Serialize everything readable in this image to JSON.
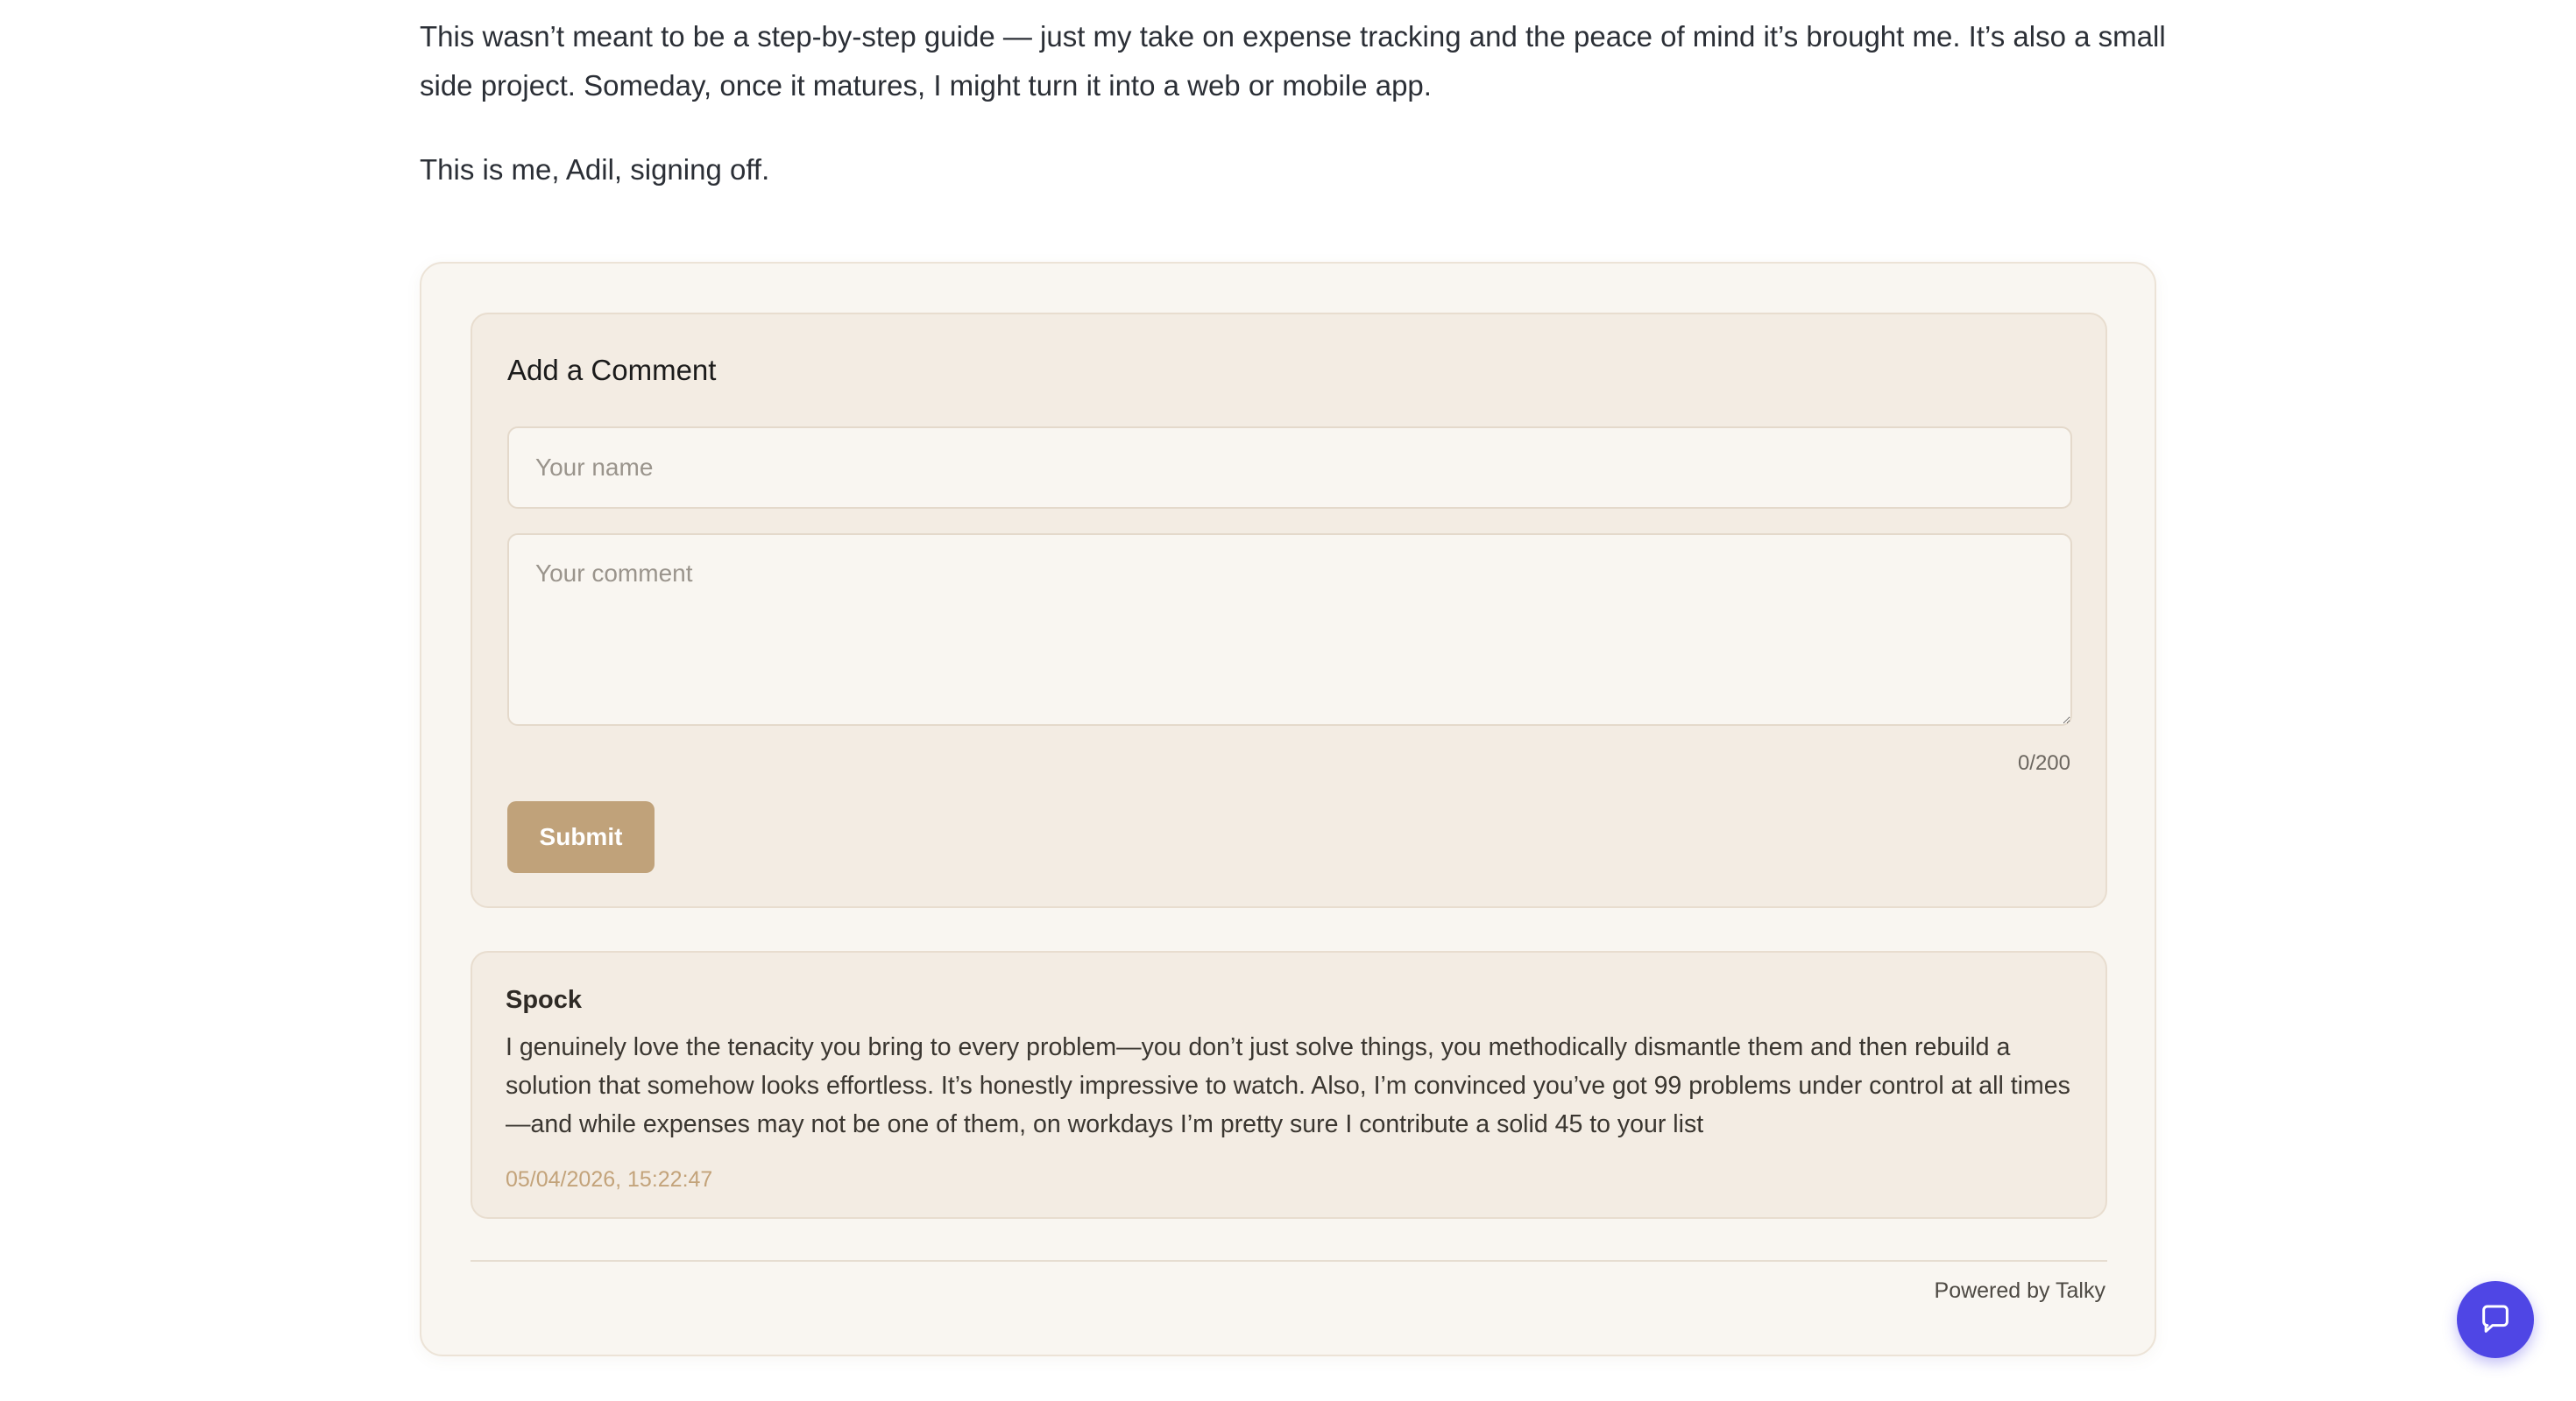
{
  "article": {
    "paragraph": "This wasn’t meant to be a step-by-step guide — just my take on expense tracking and the peace of mind it’s brought me. It’s also a small side project. Someday, once it matures, I might turn it into a web or mobile app.",
    "signoff": "This is me, Adil, signing off."
  },
  "comment_form": {
    "title": "Add a Comment",
    "name_placeholder": "Your name",
    "name_value": "",
    "comment_placeholder": "Your comment",
    "comment_value": "",
    "char_count": "0/200",
    "submit_label": "Submit"
  },
  "comments": [
    {
      "author": "Spock",
      "body": "I genuinely love the tenacity you bring to every problem—you don’t just solve things, you methodically dismantle them and then rebuild a solution that somehow looks effortless. It’s honestly impressive to watch. Also, I’m convinced you’ve got 99 problems under control at all times—and while expenses may not be one of them, on workdays I’m pretty sure I contribute a solid 45 to your list",
      "timestamp": "05/04/2026, 15:22:47"
    }
  ],
  "footer": {
    "powered_by": "Powered by Talky"
  },
  "chat_widget": {
    "icon": "chat-bubble-icon",
    "color": "#4f46e5"
  },
  "colors": {
    "accent": "#c0a27a",
    "timestamp": "#c3a37a",
    "panel_background": "#f9f6f1",
    "card_background": "#f3ece3"
  }
}
